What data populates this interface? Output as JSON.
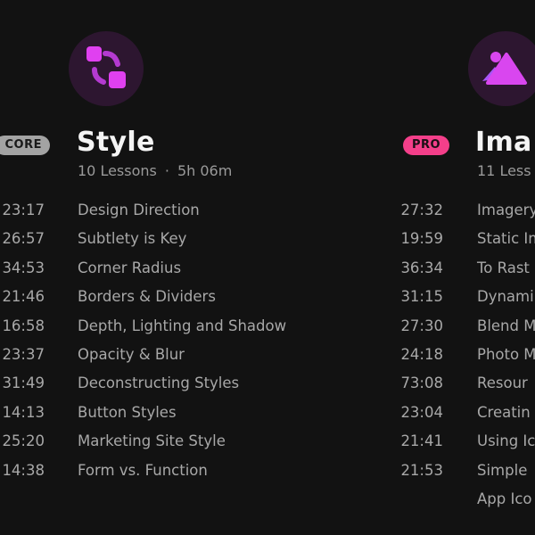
{
  "courses": [
    {
      "icon": "style-shapes-icon",
      "badge": "CORE",
      "title": "Style",
      "subtitle": {
        "lessons": "10 Lessons",
        "separator": "·",
        "duration": "5h 06m"
      },
      "lessons": [
        {
          "time": "23:17",
          "name": "Design Direction"
        },
        {
          "time": "26:57",
          "name": "Subtlety is Key"
        },
        {
          "time": "34:53",
          "name": "Corner Radius"
        },
        {
          "time": "21:46",
          "name": "Borders & Dividers"
        },
        {
          "time": "16:58",
          "name": "Depth, Lighting and Shadow"
        },
        {
          "time": "23:37",
          "name": "Opacity & Blur"
        },
        {
          "time": "31:49",
          "name": "Deconstructing Styles"
        },
        {
          "time": "14:13",
          "name": "Button Styles"
        },
        {
          "time": "25:20",
          "name": "Marketing Site Style"
        },
        {
          "time": "14:38",
          "name": "Form vs. Function"
        }
      ]
    },
    {
      "icon": "image-mountain-icon",
      "badge": "PRO",
      "title": "Ima",
      "subtitle": {
        "lessons": "11 Less"
      },
      "lessons": [
        {
          "time": "27:32",
          "name": "Imagery"
        },
        {
          "time": "19:59",
          "name": "Static Im"
        },
        {
          "time": "36:34",
          "name": "To Rast"
        },
        {
          "time": "31:15",
          "name": "Dynami"
        },
        {
          "time": "27:30",
          "name": "Blend M"
        },
        {
          "time": "24:18",
          "name": "Photo M"
        },
        {
          "time": "73:08",
          "name": "Resour"
        },
        {
          "time": "23:04",
          "name": "Creatin"
        },
        {
          "time": "21:41",
          "name": "Using Ic"
        },
        {
          "time": "21:53",
          "name": "Simple"
        },
        {
          "time": "",
          "name": "App Ico"
        }
      ]
    }
  ],
  "colors": {
    "background": "#121212",
    "icon_circle": "#2d1630",
    "accent_magenta": "#d946ef",
    "accent_purple": "#a855f7",
    "pro_badge": "#f43f8a",
    "core_badge": "#a3a3a3"
  }
}
